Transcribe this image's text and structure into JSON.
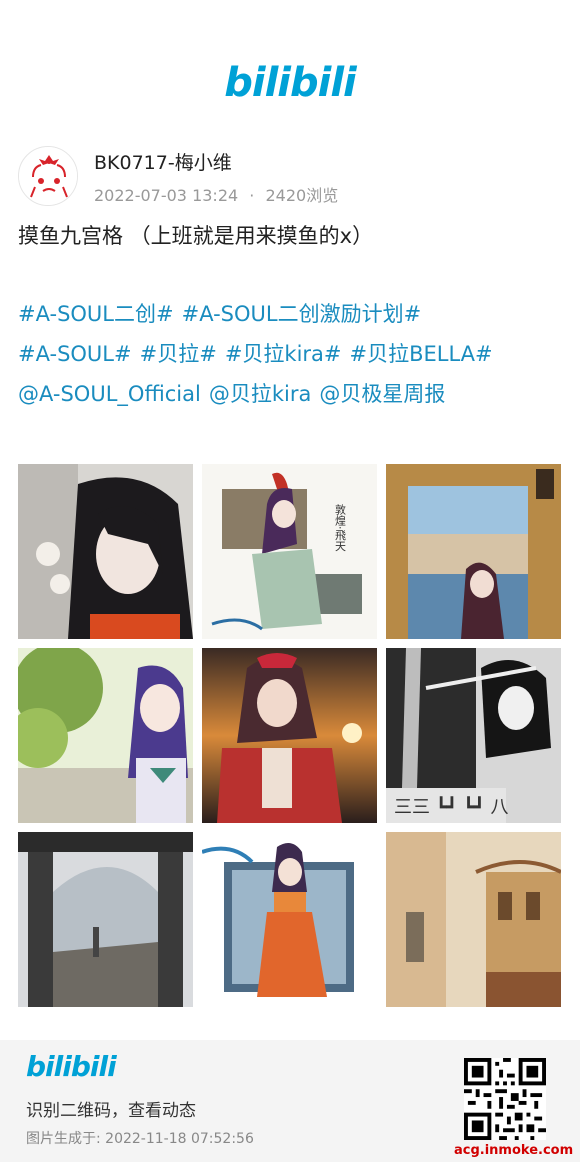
{
  "brand": {
    "logo_text": "bilibili",
    "accent": "#00a1d6"
  },
  "post": {
    "author_name": "BK0717-梅小维",
    "date": "2022-07-03 13:24",
    "separator": "·",
    "views": "2420浏览",
    "title": "摸鱼九宫格 （上班就是用来摸鱼的x）",
    "tags": [
      "#A-SOUL二创#",
      "#A-SOUL二创激励计划#",
      "#A-SOUL#",
      "#贝拉#",
      "#贝拉kira#",
      "#贝拉BELLA#",
      "@A-SOUL_Official",
      "@贝拉kira",
      "@贝极星周报"
    ],
    "tag_color": "#1a8cbf"
  },
  "gallery": {
    "images": [
      {
        "label": "gallery-image-1"
      },
      {
        "label": "gallery-image-2"
      },
      {
        "label": "gallery-image-3"
      },
      {
        "label": "gallery-image-4"
      },
      {
        "label": "gallery-image-5"
      },
      {
        "label": "gallery-image-6"
      },
      {
        "label": "gallery-image-7"
      },
      {
        "label": "gallery-image-8"
      },
      {
        "label": "gallery-image-9"
      }
    ],
    "image2_caption": "敦煌·飛天"
  },
  "footer": {
    "logo_text": "bilibili",
    "cta": "识别二维码，查看动态",
    "generated": "图片生成于: 2022-11-18 07:52:56",
    "site": "acg.inmoke.com"
  }
}
